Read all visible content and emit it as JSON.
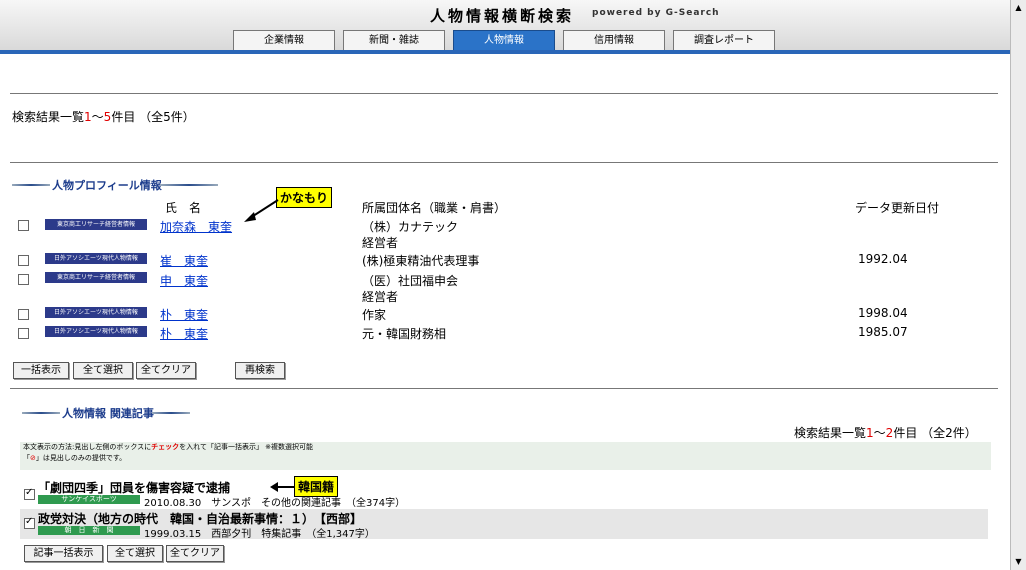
{
  "header": {
    "title": "人物情報横断検索",
    "powered": "powered by G-Search",
    "tabs": [
      "企業情報",
      "新聞・雑誌",
      "人物情報",
      "信用情報",
      "調査レポート"
    ]
  },
  "summary": {
    "prefix": "検索結果一覧",
    "from": "1",
    "sep": "～",
    "to": "5",
    "suffix": "件目",
    "total": "（全5件）"
  },
  "profile": {
    "section_title": "人物プロフィール情報",
    "col_name": "氏　名",
    "col_org": "所属団体名（職業・肩書）",
    "col_date": "データ更新日付",
    "rows": [
      {
        "source": "東京商工リサーチ経営者情報",
        "name": "加奈森　東奎",
        "org1": "（株）カナテック",
        "org2": "経営者",
        "date": ""
      },
      {
        "source": "日外アソシエーツ現代人物情報",
        "name": "崔　東奎",
        "org1": "(株)極東精油代表理事",
        "org2": "",
        "date": "1992.04"
      },
      {
        "source": "東京商工リサーチ経営者情報",
        "name": "申　東奎",
        "org1": "（医）社団福申会",
        "org2": "経営者",
        "date": ""
      },
      {
        "source": "日外アソシエーツ現代人物情報",
        "name": "朴　東奎",
        "org1": "作家",
        "org2": "",
        "date": "1998.04"
      },
      {
        "source": "日外アソシエーツ現代人物情報",
        "name": "朴　東奎",
        "org1": "元・韓国財務相",
        "org2": "",
        "date": "1985.07"
      }
    ],
    "buttons": {
      "bulk": "一括表示",
      "select_all": "全て選択",
      "clear_all": "全てクリア",
      "research": "再検索"
    },
    "callout": "かなもり"
  },
  "articles": {
    "section_title": "人物情報 関連記事",
    "summary": {
      "prefix": "検索結果一覧",
      "from": "1",
      "sep": "～",
      "to": "2",
      "suffix": "件目",
      "total": "（全2件）"
    },
    "notice1_a": "本文表示の方法:見出し左側のボックスに",
    "notice1_b": "チェック",
    "notice1_c": "を入れて「記事一括表示」 ※複数選択可能",
    "notice2_a": "「",
    "notice2_icon": "⊘",
    "notice2_b": "」は見出しのみの提供です。",
    "rows": [
      {
        "title": "「劇団四季」団員を傷害容疑で逮捕",
        "source": "サンケイスポーツ",
        "meta": "2010.08.30　サンスポ　その他の関連記事　（全374字）",
        "checked": true
      },
      {
        "title": "政党対決（地方の時代　韓国・自治最新事情：１）　【西部】",
        "source": "朝　日　新　聞",
        "meta": "1999.03.15　西部夕刊　特集記事　（全1,347字）",
        "checked": true
      }
    ],
    "buttons": {
      "bulk": "記事一括表示",
      "select_all": "全て選択",
      "clear_all": "全てクリア"
    },
    "callout": "韓国籍"
  },
  "colors": {
    "accent": "#2a66b8",
    "red": "#e00000",
    "link": "#0033cc",
    "callout": "#ffff00"
  }
}
